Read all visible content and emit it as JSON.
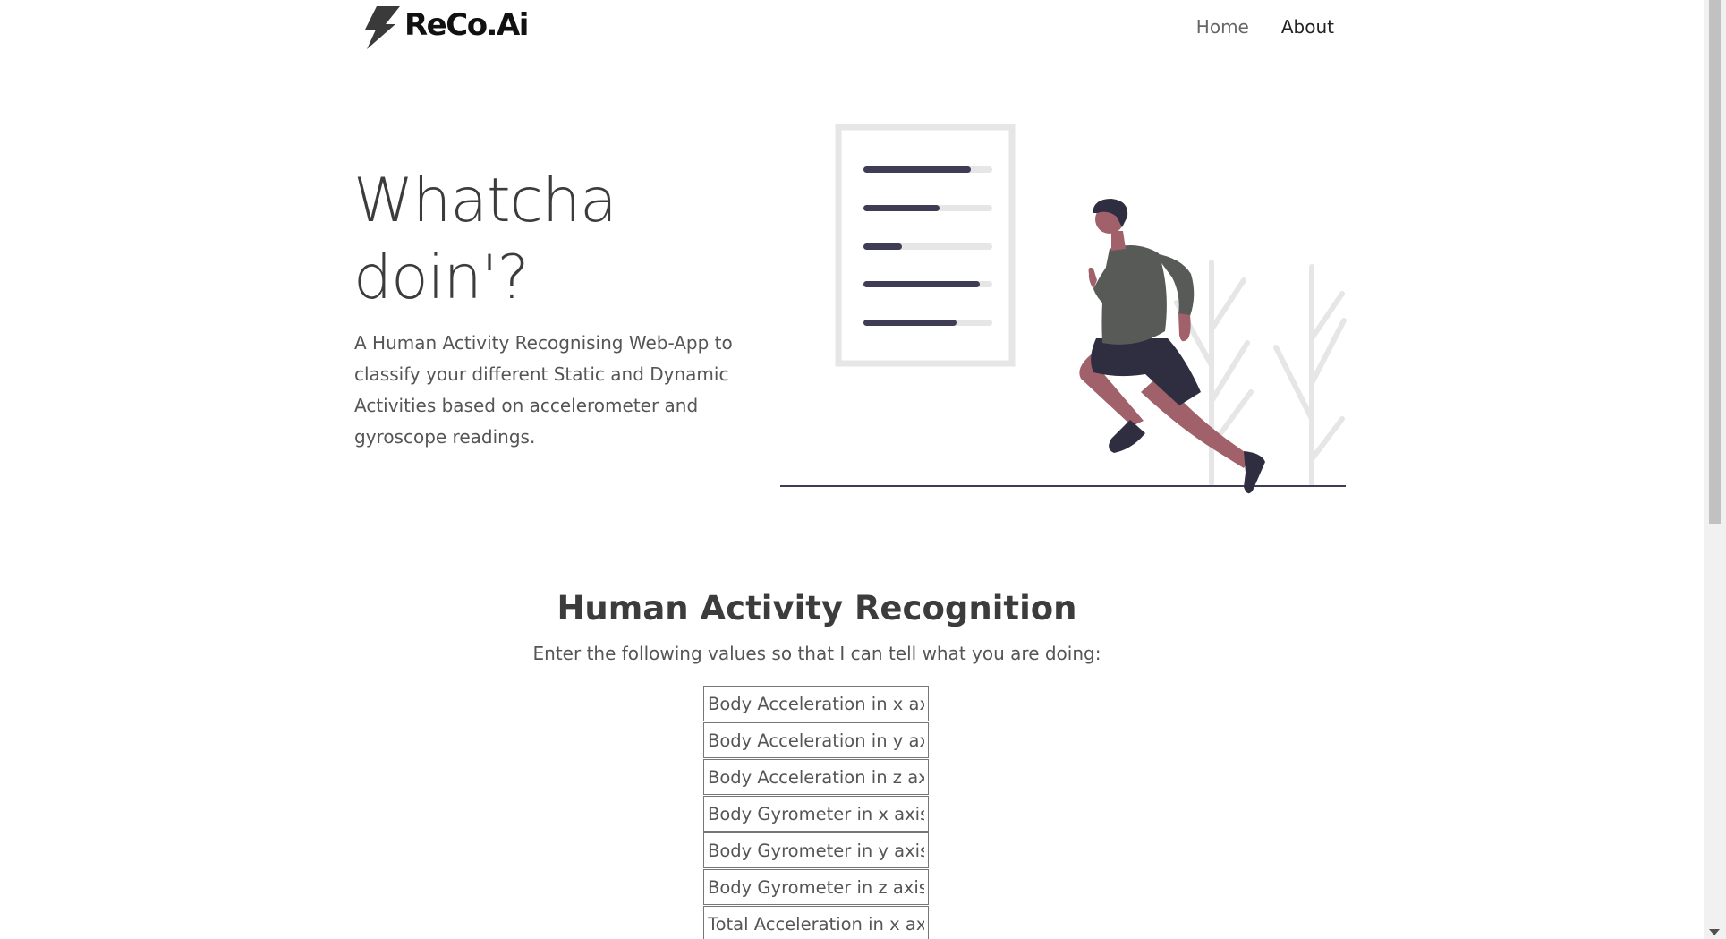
{
  "brand": {
    "name": "ReCo.Ai"
  },
  "nav": {
    "home": "Home",
    "about": "About"
  },
  "hero": {
    "title_line1": "Whatcha",
    "title_line2": "doin'?",
    "description": "A Human Activity Recognising Web-App to classify your different Static and Dynamic Activities based on accelerometer and gyroscope readings."
  },
  "form": {
    "title": "Human Activity Recognition",
    "subtitle": "Enter the following values so that I can tell what you are doing:",
    "fields": [
      {
        "placeholder": "Body Acceleration in x axis"
      },
      {
        "placeholder": "Body Acceleration in y axis"
      },
      {
        "placeholder": "Body Acceleration in z axis"
      },
      {
        "placeholder": "Body Gyrometer in x axis"
      },
      {
        "placeholder": "Body Gyrometer in y axis"
      },
      {
        "placeholder": "Body Gyrometer in z axis"
      },
      {
        "placeholder": "Total Acceleration in x axis"
      }
    ]
  },
  "icons": [
    "lightning-bolt-icon"
  ],
  "colors": {
    "skin": "#a0616a",
    "shirt": "#575a57",
    "shorts": "#2f2e41",
    "hair": "#2f2e41"
  }
}
